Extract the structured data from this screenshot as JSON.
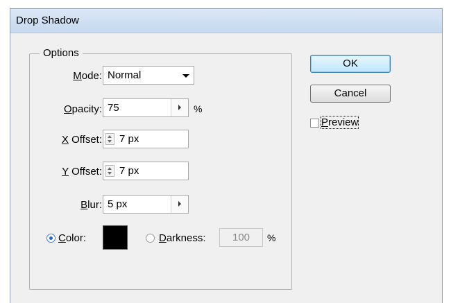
{
  "window": {
    "title": "Drop Shadow"
  },
  "options": {
    "legend": "Options",
    "mode": {
      "label_mnemonic": "M",
      "label_rest": "ode:",
      "value": "Normal"
    },
    "opacity": {
      "label_mnemonic": "O",
      "label_rest": "pacity:",
      "value": "75",
      "unit": "%"
    },
    "x_offset": {
      "label_mnemonic": "X",
      "label_rest": " Offset:",
      "value": "7 px"
    },
    "y_offset": {
      "label_mnemonic": "Y",
      "label_rest": " Offset:",
      "value": "7 px"
    },
    "blur": {
      "label_mnemonic": "B",
      "label_rest": "lur:",
      "value": "5 px"
    },
    "color": {
      "label_mnemonic": "C",
      "label_rest": "olor:",
      "selected": true,
      "swatch": "#000000"
    },
    "darkness": {
      "label_mnemonic": "D",
      "label_rest": "arkness:",
      "value": "100",
      "unit": "%",
      "selected": false
    }
  },
  "buttons": {
    "ok": "OK",
    "cancel": "Cancel"
  },
  "preview": {
    "label_mnemonic": "P",
    "label_rest": "review",
    "checked": false
  }
}
